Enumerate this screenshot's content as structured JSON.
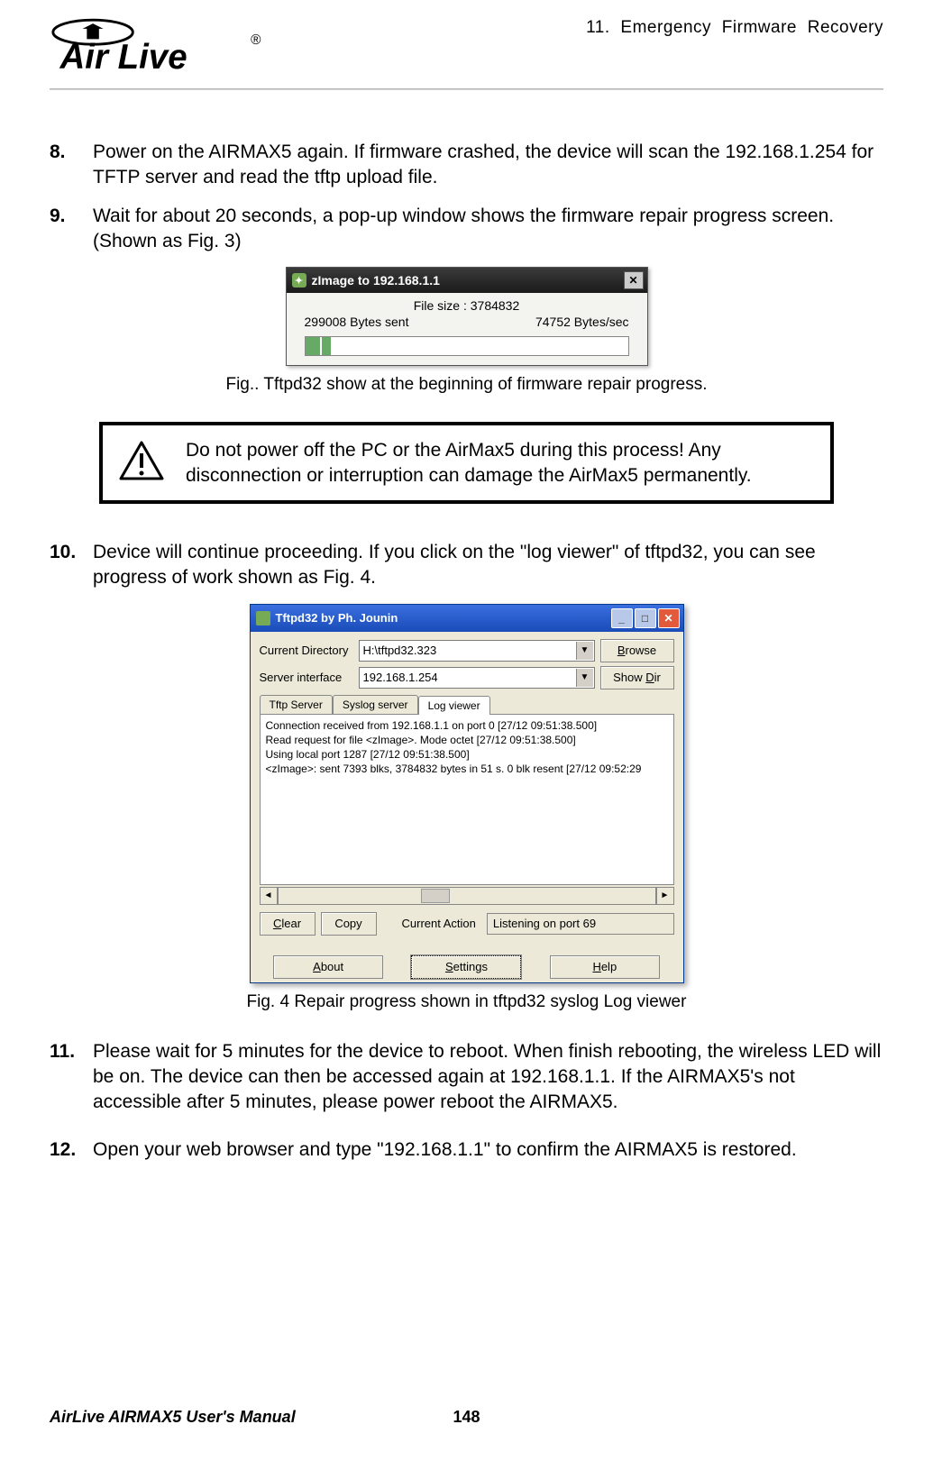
{
  "header": {
    "brand_text": "Air Live",
    "chapter": "11. Emergency Firmware Recovery"
  },
  "steps": {
    "s8": {
      "num": "8.",
      "text": "Power on the AIRMAX5 again.    If firmware crashed, the device will scan the 192.168.1.254 for TFTP server and read the tftp upload file."
    },
    "s9": {
      "num": "9.",
      "text": "Wait for about 20 seconds, a pop-up window shows the firmware repair progress screen.(Shown as Fig. 3)"
    },
    "s10": {
      "num": "10.",
      "text": "Device will continue proceeding. If you click on the \"log viewer\" of tftpd32, you can see progress of work shown as Fig. 4."
    },
    "s11": {
      "num": "11.",
      "text": "Please wait for 5 minutes for the device to reboot.    When finish rebooting, the wireless LED will be on. The device can then be accessed again at 192.168.1.1.    If the AIRMAX5's not accessible after 5 minutes, please power reboot the AIRMAX5."
    },
    "s12": {
      "num": "12.",
      "text": "Open your web browser and type \"192.168.1.1\" to confirm the AIRMAX5 is restored."
    }
  },
  "dialog1": {
    "title": "zImage to 192.168.1.1",
    "file_size": "File size : 3784832",
    "bytes_sent": "299008 Bytes sent",
    "bytes_sec": "74752 Bytes/sec"
  },
  "caption1": "Fig.. Tftpd32 show at the beginning of firmware repair progress.",
  "warning": "Do not power off the PC or the AirMax5 during this process!    Any disconnection or interruption can damage the AirMax5 permanently.",
  "dialog2": {
    "title": "Tftpd32 by Ph. Jounin",
    "cur_dir_label": "Current Directory",
    "cur_dir_value": "H:\\tftpd32.323",
    "srv_if_label": "Server interface",
    "srv_if_value": "192.168.1.254",
    "browse_btn": "Browse",
    "showdir_btn": "Show Dir",
    "tabs": {
      "t1": "Tftp Server",
      "t2": "Syslog server",
      "t3": "Log viewer"
    },
    "log": {
      "l1": "Connection received from 192.168.1.1 on port 0 [27/12 09:51:38.500]",
      "l2": "Read request for file <zImage>. Mode octet [27/12 09:51:38.500]",
      "l3": "Using local port 1287 [27/12 09:51:38.500]",
      "l4": "<zImage>: sent 7393 blks, 3784832 bytes in 51 s. 0 blk resent [27/12 09:52:29"
    },
    "clear_btn": "Clear",
    "copy_btn": "Copy",
    "ca_label": "Current Action",
    "ca_value": "Listening on port 69",
    "about_btn": "About",
    "settings_btn": "Settings",
    "help_btn": "Help"
  },
  "caption2": "Fig. 4 Repair progress shown in tftpd32 syslog Log viewer",
  "footer": {
    "manual": "AirLive AIRMAX5 User's Manual",
    "page": "148"
  }
}
